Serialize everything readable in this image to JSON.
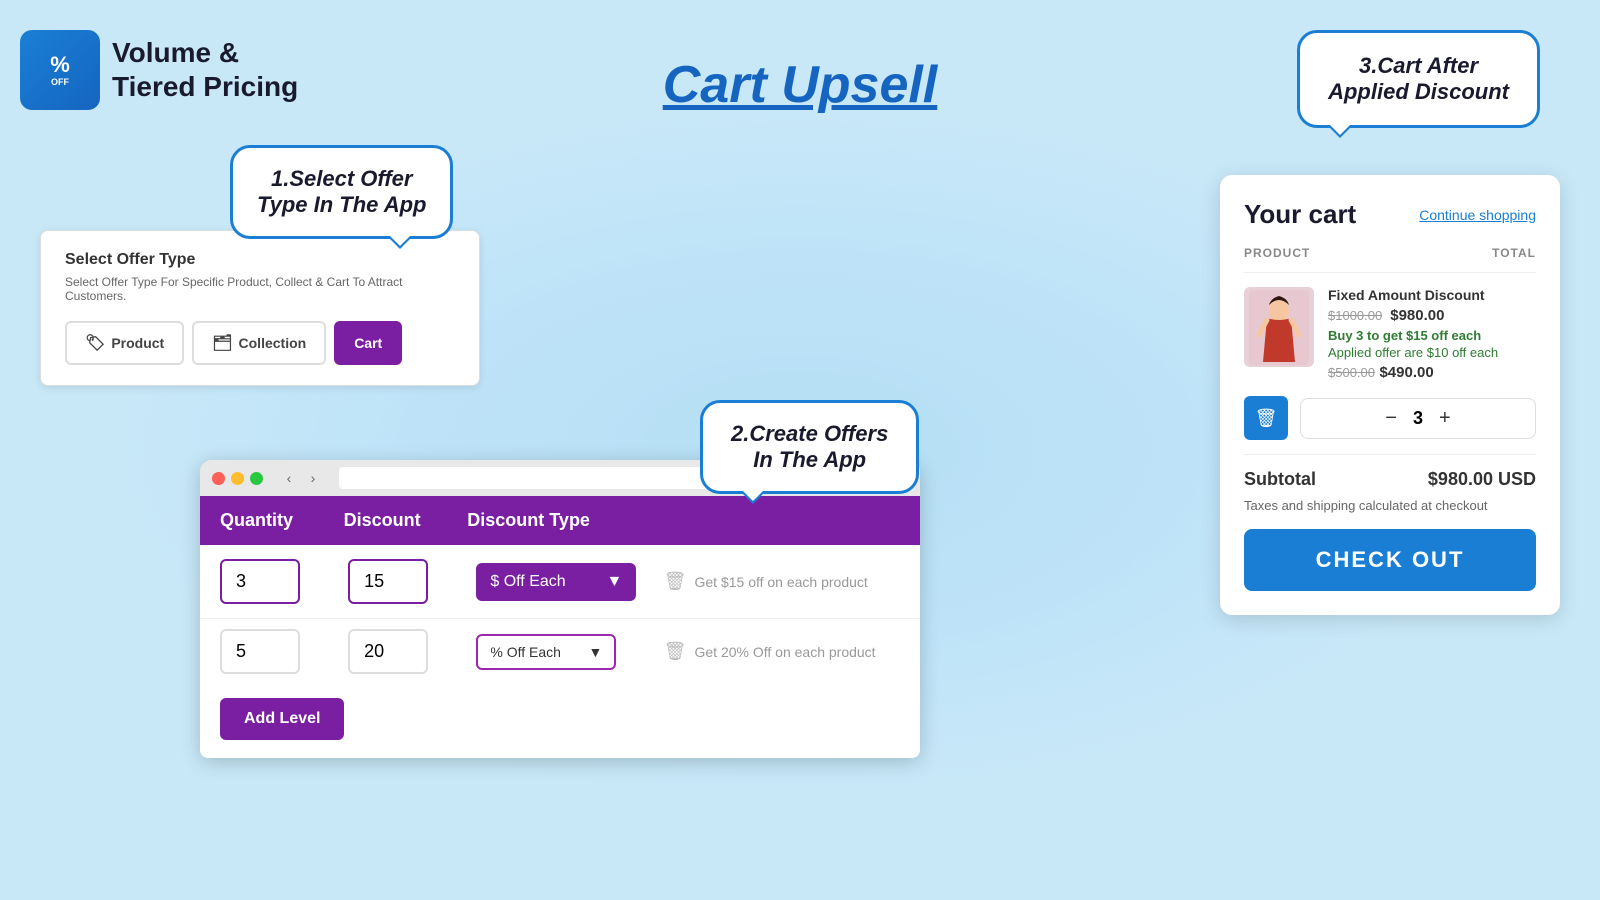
{
  "app": {
    "logo_icon": "%",
    "logo_line1": "Volume &",
    "logo_line2": "Tiered Pricing"
  },
  "page": {
    "title": "Cart Upsell"
  },
  "bubbles": {
    "bubble1": "1.Select Offer\nType In The App",
    "bubble2": "2.Create Offers\nIn The App",
    "bubble3": "3.Cart After\nApplied Discount"
  },
  "offer_panel": {
    "title": "Select Offer Type",
    "subtitle": "Select Offer Type For Specific Product, Collect & Cart To Attract Customers.",
    "buttons": [
      {
        "label": "Product",
        "active": false
      },
      {
        "label": "Collection",
        "active": false
      },
      {
        "label": "Cart",
        "active": true
      }
    ]
  },
  "table": {
    "headers": [
      "Quantity",
      "Discount",
      "Discount Type",
      ""
    ],
    "row1": {
      "quantity": "3",
      "discount": "15",
      "discount_type": "$ Off Each",
      "description": "Get $15 off on each product"
    },
    "row2": {
      "quantity": "5",
      "discount": "20",
      "discount_type": "% Off Each",
      "description": "Get 20% Off on each product"
    },
    "add_level": "Add Level"
  },
  "cart": {
    "title": "Your cart",
    "continue_shopping": "Continue shopping",
    "col_product": "PRODUCT",
    "col_total": "TOTAL",
    "item": {
      "name": "Fixed Amount Discount",
      "original_price": "$1000.00",
      "discounted_price": "$980.00",
      "offer_text": "Buy 3 to get $15 off each",
      "applied_text": "Applied offer are $10 off each",
      "price_before": "$500.00",
      "price_after": "$490.00"
    },
    "quantity": "3",
    "subtotal_label": "Subtotal",
    "subtotal_value": "$980.00 USD",
    "tax_note": "Taxes and shipping calculated at checkout",
    "checkout_label": "CHECK OUT"
  }
}
